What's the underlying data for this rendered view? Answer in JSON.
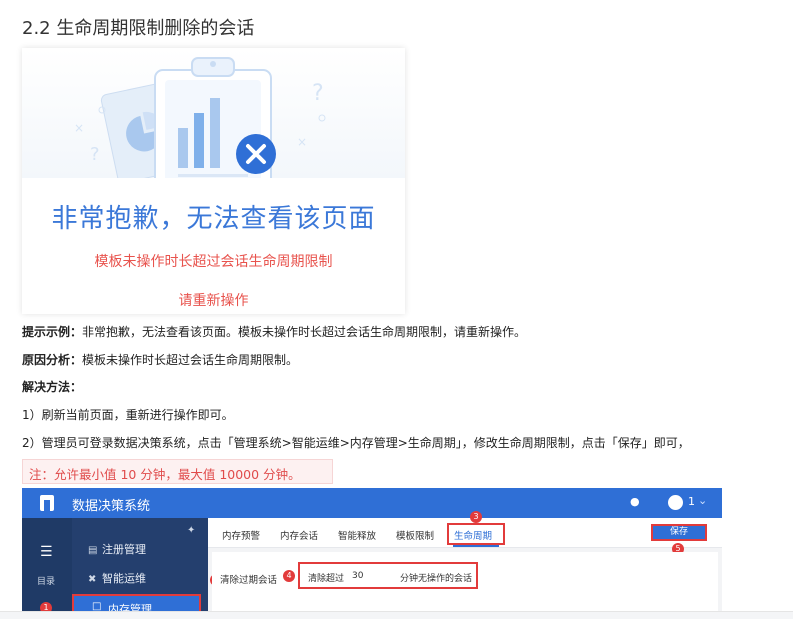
{
  "heading": "2.2 生命周期限制删除的会话",
  "error_card": {
    "title": "非常抱歉，无法查看该页面",
    "message": "模板未操作时长超过会话生命周期限制",
    "retry": "请重新操作"
  },
  "lines": {
    "hint_label": "提示示例：",
    "hint_text": "非常抱歉，无法查看该页面。模板未操作时长超过会话生命周期限制，请重新操作。",
    "reason_label": "原因分析：",
    "reason_text": "模板未操作时长超过会话生命周期限制。",
    "solution_label": "解决方法：",
    "step1": "1）刷新当前页面，重新进行操作即可。",
    "step2": "2）管理员可登录数据决策系统，点击「管理系统>智能运维>内存管理>生命周期」，修改生命周期限制，点击「保存」即可，"
  },
  "note": "注：允许最小值 10 分钟，最大值 10000 分钟。",
  "screenshot": {
    "app_title": "数据决策系统",
    "user_name": "1",
    "rail_label": "目录",
    "sidebar": {
      "items": [
        "注册管理",
        "智能运维"
      ],
      "selected": "内存管理"
    },
    "tabs": [
      "内存预警",
      "内存会话",
      "智能释放",
      "模板限制",
      "生命周期"
    ],
    "active_tab": "生命周期",
    "save_label": "保存",
    "field_label": "清除过期会话",
    "field_prefix": "清除超过",
    "field_value": "30",
    "field_suffix": "分钟无操作的会话",
    "markers": [
      "1",
      "2",
      "3",
      "4",
      "5"
    ]
  },
  "colors": {
    "brand_blue": "#2f6fd6",
    "error_title": "#3b78d8",
    "error_red": "#e8534d",
    "marker_red": "#e23b3b",
    "sidebar_dark": "#243f6e"
  }
}
